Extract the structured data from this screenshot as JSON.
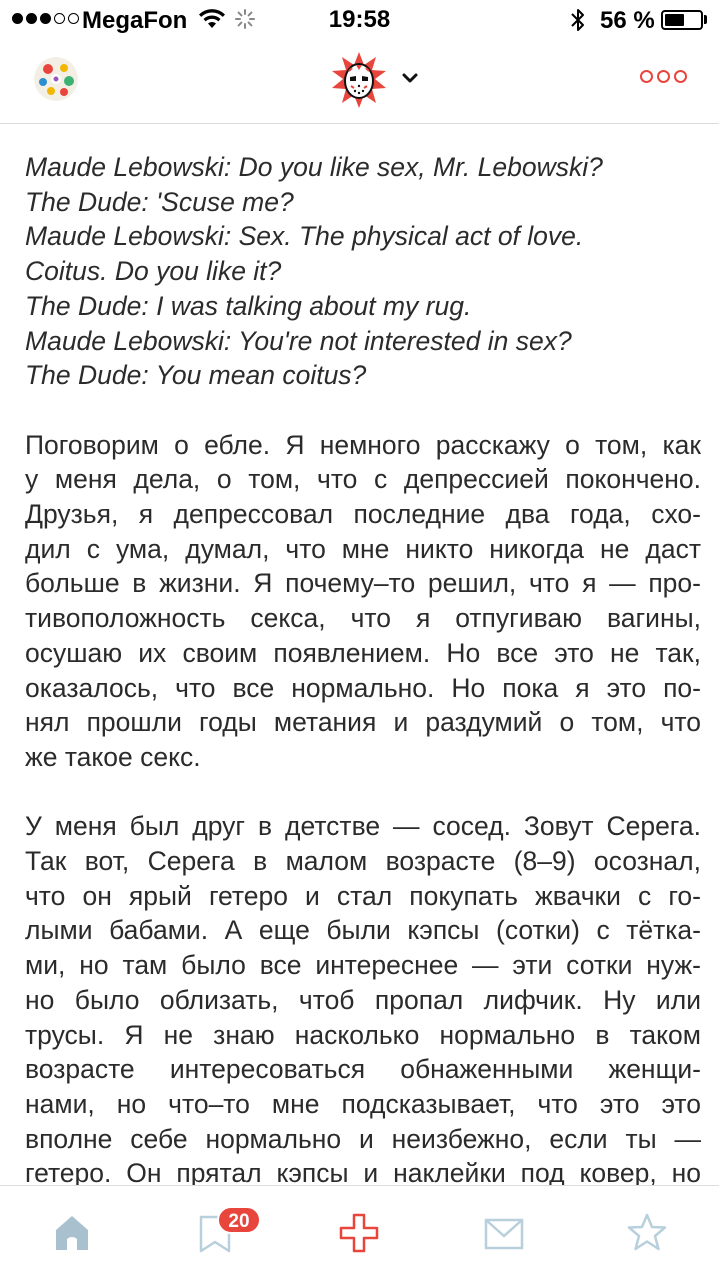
{
  "status_bar": {
    "carrier": "MegaFon",
    "time": "19:58",
    "battery_percent": "56 %",
    "battery_level": 0.56,
    "signal_bars_filled": 3,
    "signal_bars_total": 5
  },
  "nav": {
    "avatar_icon": "avatar-multicolor-icon",
    "logo_icon": "hockey-mask-logo-icon",
    "chevron_icon": "chevron-down-icon",
    "more_icon": "more-dots-icon",
    "accent_color": "#e8453c"
  },
  "post": {
    "quote_lines": [
      "Maude Lebowski: Do you like sex, Mr. Lebowski?",
      "The Dude: 'Scuse me?",
      "Maude Lebowski: Sex. The physical act of love.",
      "Coitus. Do you like it?",
      "The Dude: I was talking about my rug.",
      "Maude Lebowski: You're not interested in sex?",
      "The Dude: You mean coitus?"
    ],
    "paragraph1": [
      "Поговорим о ебле. Я немного расскажу о том, как",
      "у меня дела, о том, что с депрессией покончено.",
      "Друзья, я депрессовал последние два года, схо-",
      "дил с ума, думал, что мне никто никогда не даст",
      "больше в жизни. Я почему–то решил, что я — про-",
      "тивоположность секса, что я отпугиваю вагины,",
      "осушаю их своим появлением. Но все это не так,",
      "оказалось, что все нормально. Но пока я это по-",
      "нял прошли годы метания и раздумий о том, что",
      "же такое секс."
    ],
    "paragraph2": [
      "У меня был друг в детстве — сосед. Зовут Серега.",
      "Так вот, Серега в малом возрасте (8–9) осознал,",
      "что он ярый гетеро и стал покупать жвачки с го-",
      "лыми бабами. А еще были кэпсы (сотки) с тётка-",
      "ми, но там было все интереснее — эти сотки нуж-",
      "но было облизать, чтоб пропал лифчик. Ну или",
      "трусы. Я не знаю насколько нормально в таком",
      "возрасте интересоваться обнаженными женщи-",
      "нами, но что–то мне подсказывает, что это это",
      "вполне себе нормально и неизбежно, если ты —",
      "гетеро. Он прятал кэпсы и наклейки под ковер, но"
    ]
  },
  "tab_bar": {
    "home_icon": "home-icon",
    "bookmarks_icon": "bookmark-icon",
    "bookmarks_badge": "20",
    "add_icon": "add-post-icon",
    "mail_icon": "mail-icon",
    "favorites_icon": "star-icon",
    "active_color": "#a9c1cf",
    "inactive_color": "#b8cfdc"
  }
}
